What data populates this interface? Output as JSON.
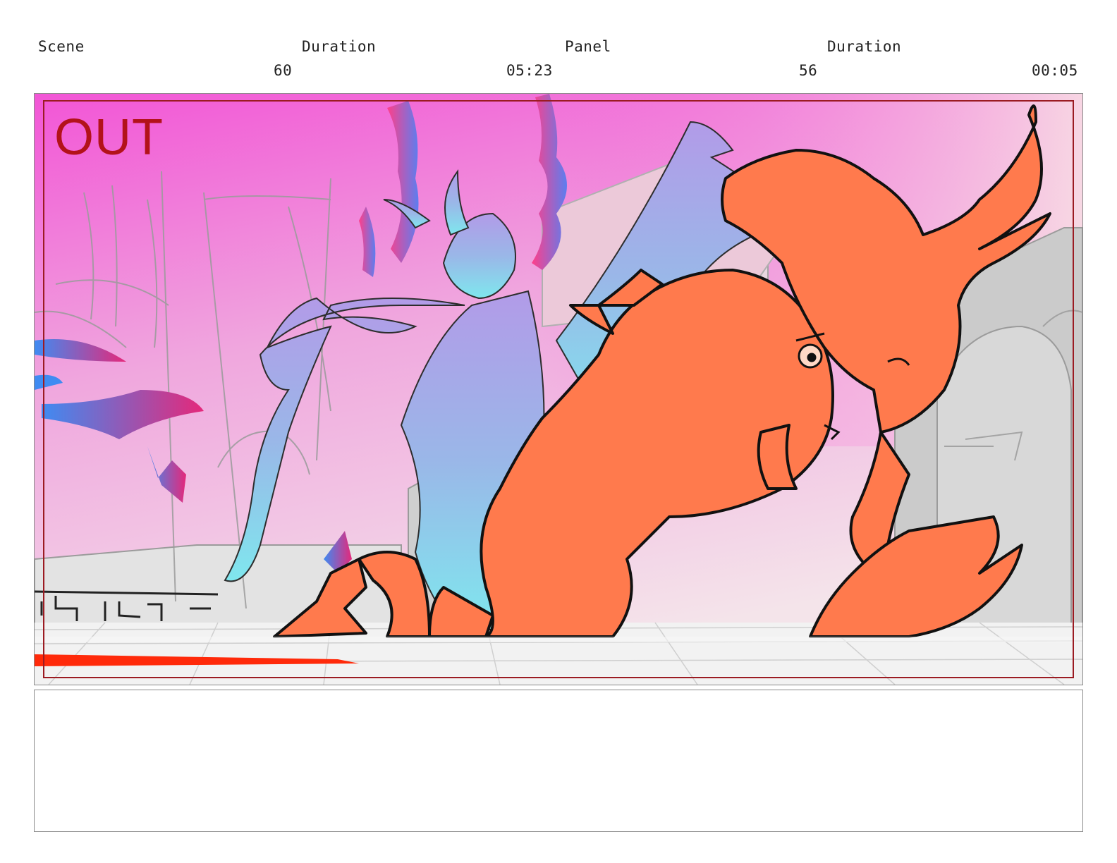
{
  "header": {
    "scene_label": "Scene",
    "duration_label": "Duration",
    "panel_label": "Panel",
    "panel_duration_label": "Duration",
    "scene_number": "60",
    "scene_duration": "05:23",
    "panel_number": "56",
    "panel_duration": "00:05"
  },
  "frame": {
    "marker_text": "OUT",
    "marker_color": "#b3121a",
    "sky_top_color": "#f255d6",
    "sky_bottom_color": "#f4e4ea",
    "foreground_character_color": "#ff7a4d",
    "background_figure_colors": [
      "#9aa6ea",
      "#7fe7ee"
    ]
  },
  "notes": {
    "text": ""
  }
}
